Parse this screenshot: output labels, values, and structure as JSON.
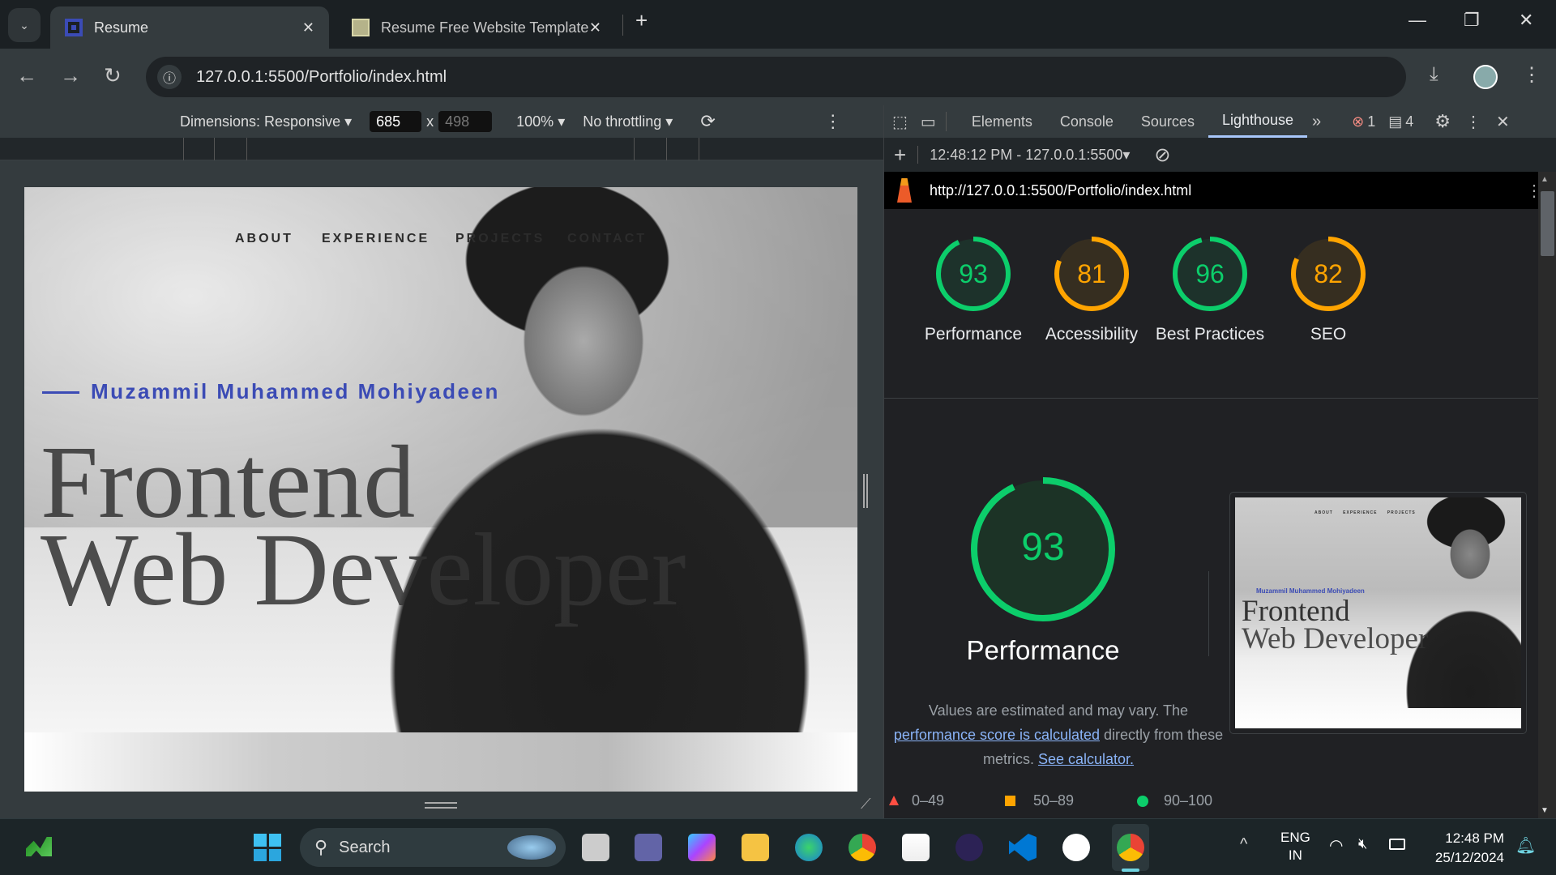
{
  "browser": {
    "tabs": [
      {
        "title": "Resume",
        "active": true
      },
      {
        "title": "Resume Free Website Template",
        "active": false
      }
    ],
    "url": "127.0.0.1:5500/Portfolio/index.html"
  },
  "device_toolbar": {
    "dimensions": "Dimensions: Responsive",
    "width": "685",
    "times": "x",
    "height": "498",
    "zoom": "100%",
    "throttling": "No throttling"
  },
  "page": {
    "nav": [
      "ABOUT",
      "EXPERIENCE",
      "PROJECTS",
      "CONTACT"
    ],
    "name": "Muzammil Muhammed Mohiyadeen",
    "headline1": "Frontend",
    "headline2": "Web Developer",
    "accent": "#3b4bb5"
  },
  "devtools": {
    "tabs": [
      "Elements",
      "Console",
      "Sources",
      "Lighthouse"
    ],
    "active_tab": "Lighthouse",
    "errors": "1",
    "messages": "4",
    "report_selector": "12:48:12 PM - 127.0.0.1:5500",
    "report_url": "http://127.0.0.1:5500/Portfolio/index.html",
    "scores": [
      {
        "label": "Performance",
        "value": 93,
        "color": "#0cce6b"
      },
      {
        "label": "Accessibility",
        "value": 81,
        "color": "#ffa400"
      },
      {
        "label": "Best Practices",
        "value": 96,
        "color": "#0cce6b"
      },
      {
        "label": "SEO",
        "value": 82,
        "color": "#ffa400"
      }
    ],
    "focus": {
      "value": 93,
      "label": "Performance",
      "desc1": "Values are estimated and may vary. The",
      "link1": "performance score is calculated",
      "desc2": " directly from these",
      "desc3": "metrics. ",
      "link2": "See calculator."
    },
    "thumb": {
      "nav": [
        "ABOUT",
        "EXPERIENCE",
        "PROJECTS"
      ],
      "name": "Muzammil Muhammed Mohiyadeen",
      "headline1": "Frontend",
      "headline2": "Web Developer"
    },
    "legend": [
      "0–49",
      "50–89",
      "90–100"
    ],
    "legend_colors": [
      "#ff4e42",
      "#ffa400",
      "#0cce6b"
    ]
  },
  "taskbar": {
    "search": "Search",
    "lang1": "ENG",
    "lang2": "IN",
    "time": "12:48 PM",
    "date": "25/12/2024"
  }
}
